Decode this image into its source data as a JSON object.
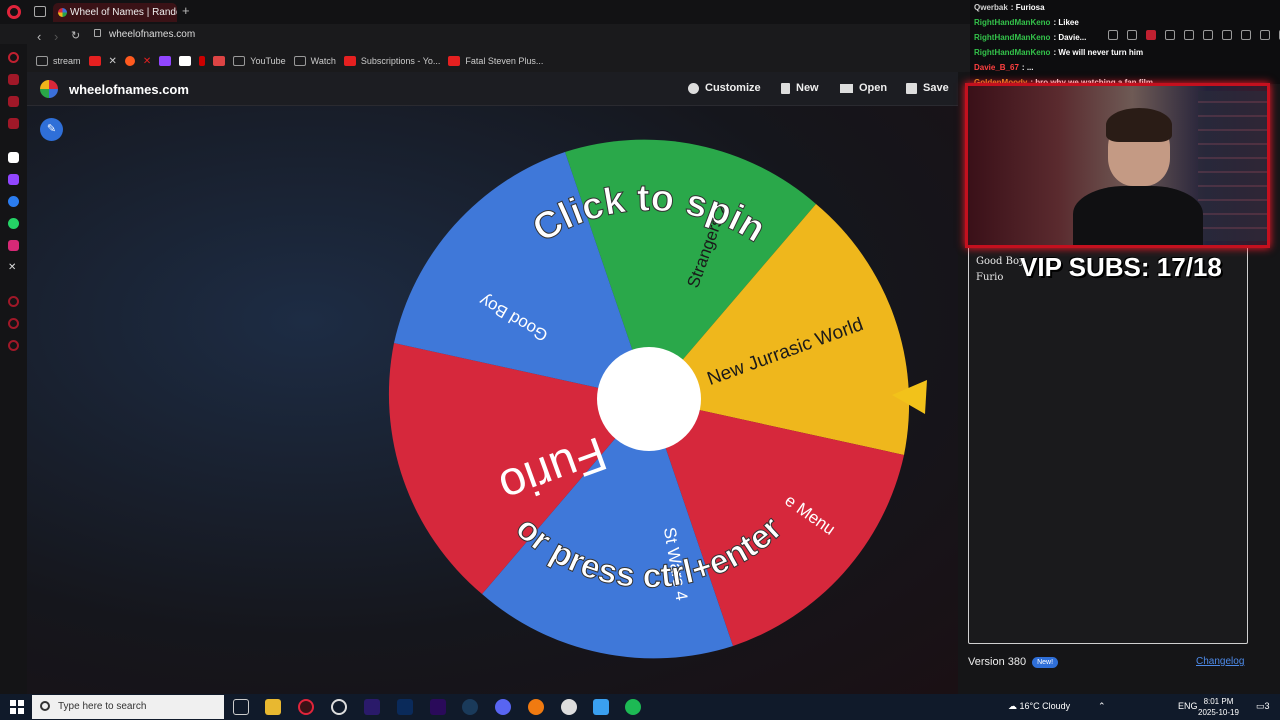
{
  "browser": {
    "tab_title": "Wheel of Names | Random",
    "new_tab_label": "+",
    "url": "wheelofnames.com",
    "bookmarks": [
      {
        "label": "stream"
      },
      {
        "label": ""
      },
      {
        "label": ""
      },
      {
        "label": ""
      },
      {
        "label": ""
      },
      {
        "label": ""
      },
      {
        "label": ""
      },
      {
        "label": ""
      },
      {
        "label": "YouTube"
      },
      {
        "label": "Watch"
      },
      {
        "label": "Subscriptions - Yo..."
      },
      {
        "label": "Fatal Steven Plus..."
      }
    ]
  },
  "site": {
    "name": "wheelofnames.com",
    "header_buttons": {
      "customize": "Customize",
      "new": "New",
      "open": "Open",
      "save": "Save"
    },
    "wheel": {
      "top_prompt": "Click to spin",
      "bottom_prompt": "or press ctrl+enter",
      "slice_labels": [
        "Strangers 2",
        "New Jurrasic World",
        "e Menu",
        "St Wars 4",
        "Furio",
        "Good Boy"
      ],
      "colors": {
        "green": "#2aa84a",
        "yellow": "#efb71c",
        "red": "#d6283c",
        "blue": "#3f78d9"
      }
    },
    "entries": [
      "Good Boy",
      "Furio"
    ],
    "version": "Version 380",
    "new_badge": "New!",
    "changelog": "Changelog"
  },
  "overlay": {
    "vip_subs": "VIP SUBS: 17/18",
    "chat": [
      {
        "user": "Qwerbak",
        "msg": "Furiosa",
        "color": "#d0d0d0"
      },
      {
        "user": "RightHandManKeno",
        "msg": "Likee",
        "color": "#33c24a"
      },
      {
        "user": "RightHandManKeno",
        "msg": "Davie...",
        "color": "#33c24a"
      },
      {
        "user": "RightHandManKeno",
        "msg": "We will never turn him",
        "color": "#33c24a"
      },
      {
        "user": "Davie_B_67",
        "msg": "...",
        "color": "#ff4040"
      },
      {
        "user": "GoldenMoody",
        "msg": "bro why we watching a fan film",
        "color": "#e0a020"
      }
    ]
  },
  "taskbar": {
    "search_placeholder": "Type here to search",
    "weather": "16°C  Cloudy",
    "language": "ENG",
    "time": "8:01 PM",
    "date": "2025-10-19",
    "notifications": "3"
  }
}
